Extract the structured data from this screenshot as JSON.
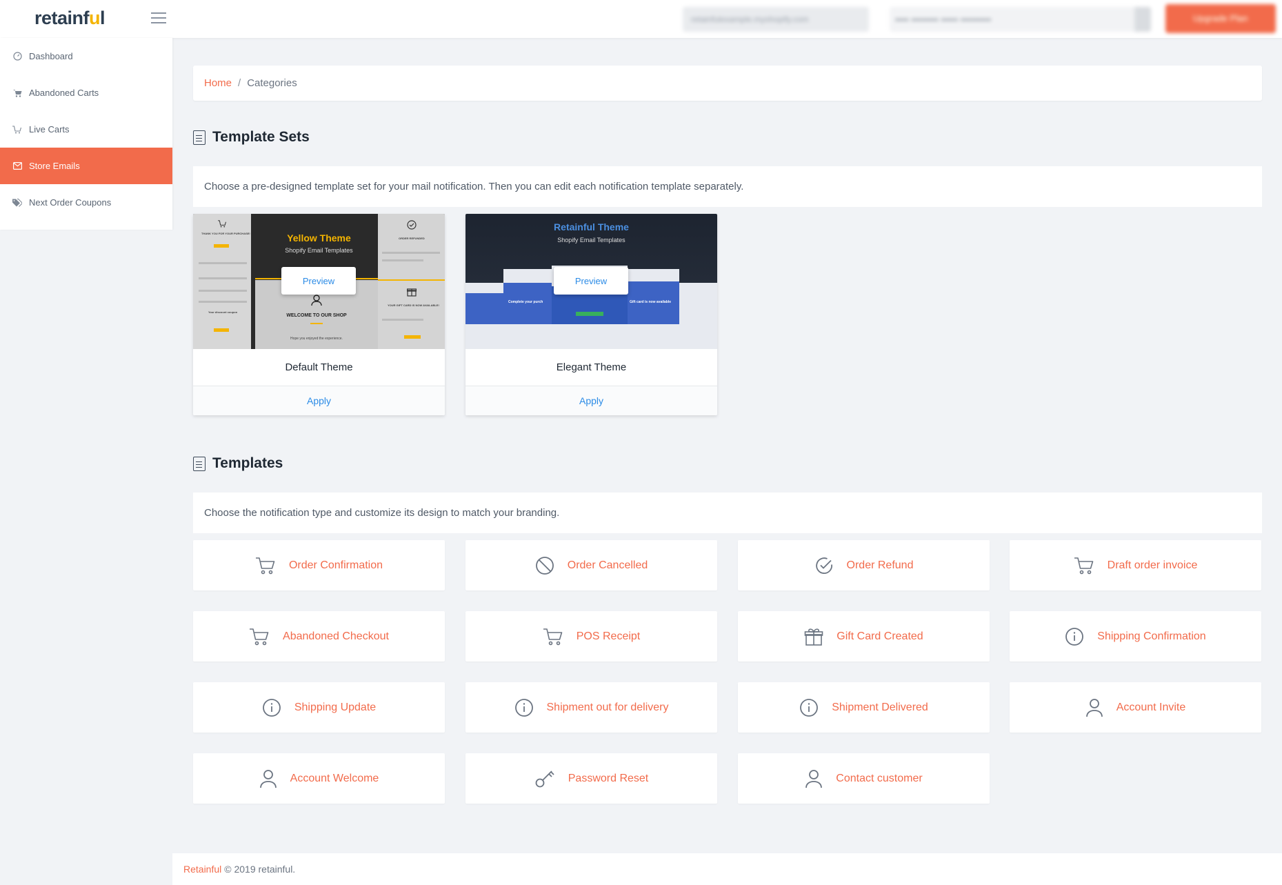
{
  "app": {
    "logo_prefix": "retainf",
    "logo_u": "u",
    "logo_suffix": "l"
  },
  "topbar": {
    "store_selector": "retainfulexample.myshopify.com",
    "plan_info": "•••• •••••••• ••••• •••••••••",
    "upgrade_button": "Upgrade Plan"
  },
  "sidebar": {
    "items": [
      {
        "label": "Dashboard",
        "icon": "dashboard-icon"
      },
      {
        "label": "Abandoned Carts",
        "icon": "cart-icon"
      },
      {
        "label": "Live Carts",
        "icon": "cart-outline-icon"
      },
      {
        "label": "Store Emails",
        "icon": "envelope-icon",
        "active": true
      },
      {
        "label": "Next Order Coupons",
        "icon": "tags-icon"
      }
    ]
  },
  "breadcrumb": {
    "home": "Home",
    "separator": "/",
    "current": "Categories"
  },
  "template_sets": {
    "title": "Template Sets",
    "description": "Choose a pre-designed template set for your mail notification. Then you can edit each notification template separately.",
    "themes": [
      {
        "name": "Default Theme",
        "apply_label": "Apply",
        "preview_label": "Preview",
        "image_title": "Yellow Theme",
        "image_subtitle": "Shopify Email Templates",
        "image_texts": {
          "thanks": "THANK YOU FOR YOUR PURCHASE!",
          "refunded": "ORDER REFUNDED",
          "welcome": "WELCOME TO OUR SHOP",
          "welcome_sub": "Hope you enjoyed the experience.",
          "giftcard": "YOUR GIFT CARD IS NOW AVAILABLE!",
          "discount": "Your discount coupon"
        }
      },
      {
        "name": "Elegant Theme",
        "apply_label": "Apply",
        "preview_label": "Preview",
        "image_title": "Retainful Theme",
        "image_subtitle": "Shopify Email Templates",
        "image_texts": {
          "complete": "Complete your purch",
          "giftcard": "Gift card is now available"
        }
      }
    ]
  },
  "templates": {
    "title": "Templates",
    "description": "Choose the notification type and customize its design to match your branding.",
    "items": [
      {
        "label": "Order Confirmation",
        "icon": "cart-icon"
      },
      {
        "label": "Order Cancelled",
        "icon": "ban-icon"
      },
      {
        "label": "Order Refund",
        "icon": "check-circle-icon"
      },
      {
        "label": "Draft order invoice",
        "icon": "cart-icon"
      },
      {
        "label": "Abandoned Checkout",
        "icon": "cart-icon"
      },
      {
        "label": "POS Receipt",
        "icon": "cart-icon"
      },
      {
        "label": "Gift Card Created",
        "icon": "gift-icon"
      },
      {
        "label": "Shipping Confirmation",
        "icon": "info-icon"
      },
      {
        "label": "Shipping Update",
        "icon": "info-icon"
      },
      {
        "label": "Shipment out for delivery",
        "icon": "info-icon"
      },
      {
        "label": "Shipment Delivered",
        "icon": "info-icon"
      },
      {
        "label": "Account Invite",
        "icon": "user-icon"
      },
      {
        "label": "Account Welcome",
        "icon": "user-icon"
      },
      {
        "label": "Password Reset",
        "icon": "key-icon"
      },
      {
        "label": "Contact customer",
        "icon": "user-icon"
      }
    ]
  },
  "footer": {
    "brand": "Retainful",
    "copyright": "© 2019 retainful."
  },
  "colors": {
    "accent": "#f26b4b",
    "link_blue": "#2b8be6",
    "yellow": "#f4b400",
    "background": "#f1f3f6"
  }
}
